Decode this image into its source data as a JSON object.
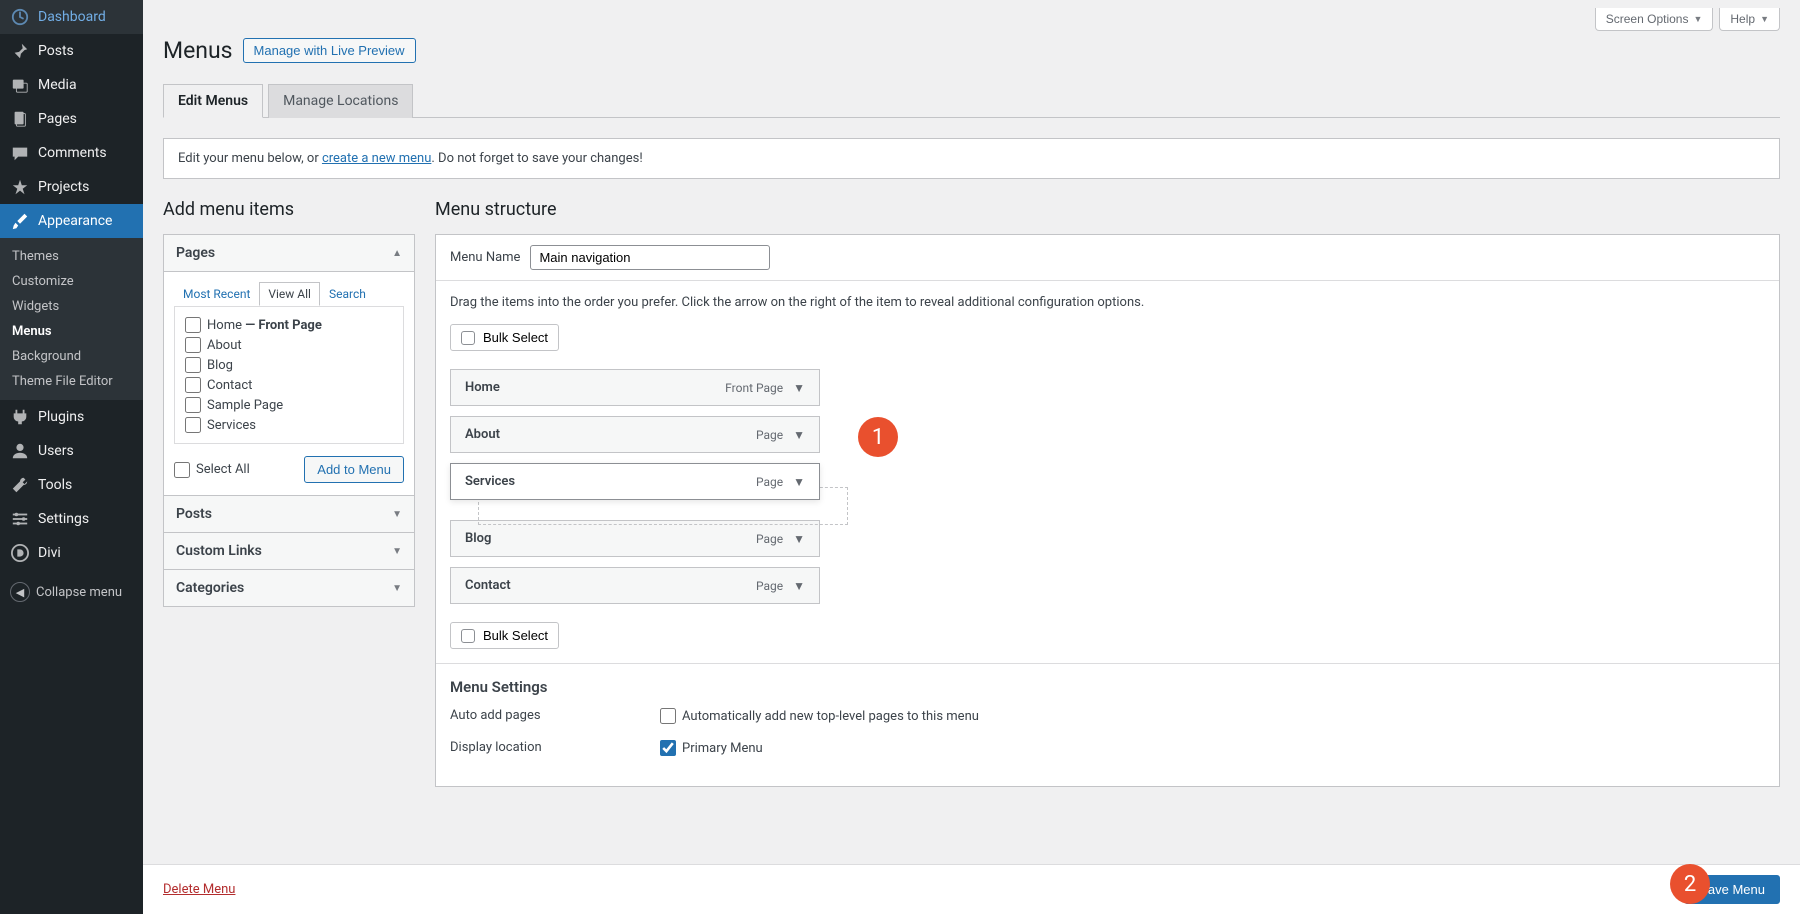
{
  "topUtil": {
    "screenOptions": "Screen Options",
    "help": "Help"
  },
  "sidebar": {
    "items": [
      {
        "label": "Dashboard",
        "icon": "dashboard"
      },
      {
        "label": "Posts",
        "icon": "pin"
      },
      {
        "label": "Media",
        "icon": "media"
      },
      {
        "label": "Pages",
        "icon": "pages"
      },
      {
        "label": "Comments",
        "icon": "comment"
      },
      {
        "label": "Projects",
        "icon": "star"
      },
      {
        "label": "Appearance",
        "icon": "brush"
      },
      {
        "label": "Plugins",
        "icon": "plug"
      },
      {
        "label": "Users",
        "icon": "user"
      },
      {
        "label": "Tools",
        "icon": "wrench"
      },
      {
        "label": "Settings",
        "icon": "settings"
      },
      {
        "label": "Divi",
        "icon": "divi"
      }
    ],
    "appearanceSub": [
      "Themes",
      "Customize",
      "Widgets",
      "Menus",
      "Background",
      "Theme File Editor"
    ],
    "collapse": "Collapse menu"
  },
  "header": {
    "title": "Menus",
    "action": "Manage with Live Preview"
  },
  "tabs": [
    "Edit Menus",
    "Manage Locations"
  ],
  "notice": {
    "pre": "Edit your menu below, or ",
    "link": "create a new menu",
    "post": ". Do not forget to save your changes!"
  },
  "leftCol": {
    "title": "Add menu items",
    "pagesHeader": "Pages",
    "pageTabs": [
      "Most Recent",
      "View All",
      "Search"
    ],
    "pageItems": [
      {
        "label": "Home",
        "suffix": " — Front Page"
      },
      {
        "label": "About"
      },
      {
        "label": "Blog"
      },
      {
        "label": "Contact"
      },
      {
        "label": "Sample Page"
      },
      {
        "label": "Services"
      }
    ],
    "selectAll": "Select All",
    "addToMenu": "Add to Menu",
    "sections": [
      "Posts",
      "Custom Links",
      "Categories"
    ]
  },
  "rightCol": {
    "title": "Menu structure",
    "menuNameLabel": "Menu Name",
    "menuNameValue": "Main navigation",
    "instruct": "Drag the items into the order you prefer. Click the arrow on the right of the item to reveal additional configuration options.",
    "bulkSelect": "Bulk Select",
    "menuItems": [
      {
        "title": "Home",
        "type": "Front Page"
      },
      {
        "title": "About",
        "type": "Page"
      },
      {
        "title": "Services",
        "type": "Page",
        "dragging": true
      },
      {
        "title": "Blog",
        "type": "Page"
      },
      {
        "title": "Contact",
        "type": "Page"
      }
    ],
    "settings": {
      "title": "Menu Settings",
      "autoAddLabel": "Auto add pages",
      "autoAddOption": "Automatically add new top-level pages to this menu",
      "displayLabel": "Display location",
      "displayOptions": [
        "Primary Menu"
      ]
    }
  },
  "footer": {
    "delete": "Delete Menu",
    "save": "Save Menu"
  },
  "annotations": {
    "one": "1",
    "two": "2"
  }
}
